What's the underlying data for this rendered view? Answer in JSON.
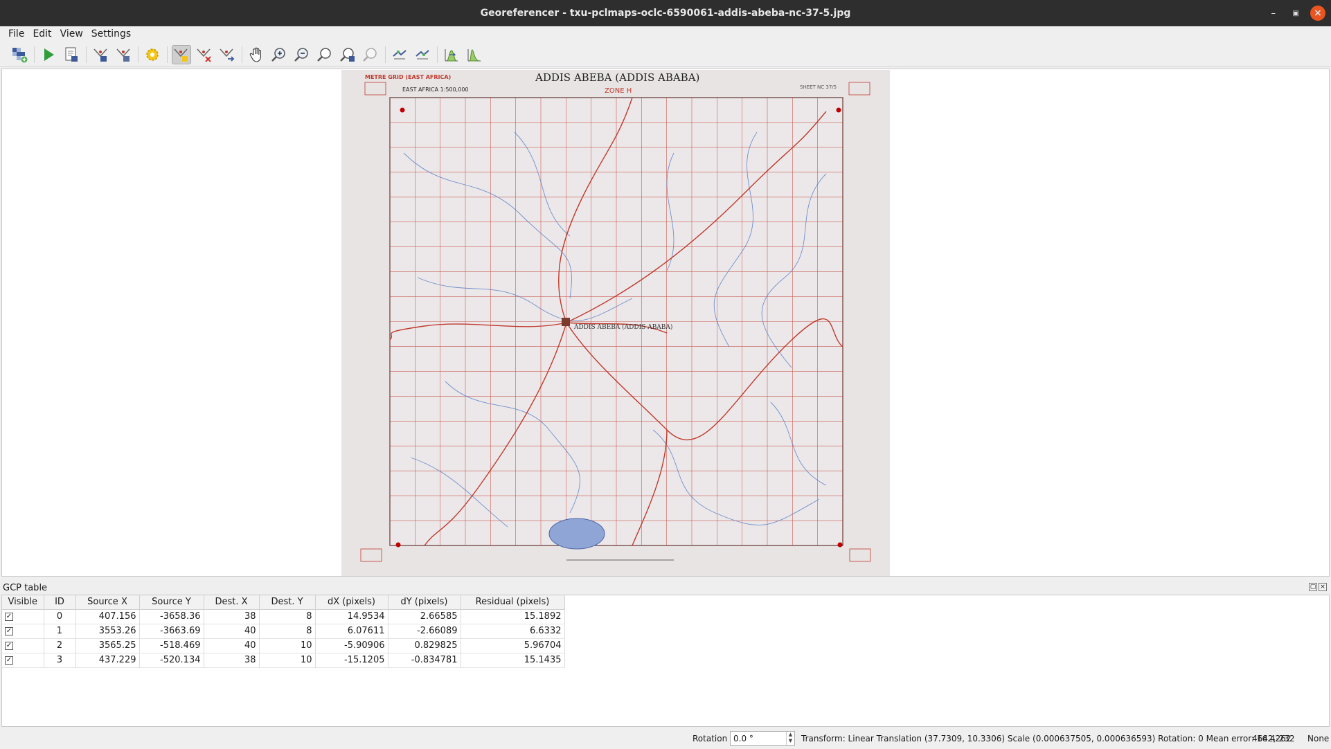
{
  "window": {
    "title": "Georeferencer - txu-pclmaps-oclc-6590061-addis-abeba-nc-37-5.jpg"
  },
  "menu": [
    "File",
    "Edit",
    "View",
    "Settings"
  ],
  "toolbar": {
    "buttons": [
      {
        "name": "open-raster-icon"
      },
      {
        "name": "start-georeferencing-icon"
      },
      {
        "name": "generate-gdal-script-icon"
      },
      {
        "name": "load-gcp-points-icon"
      },
      {
        "name": "save-gcp-points-icon"
      },
      {
        "name": "transformation-settings-icon"
      },
      {
        "name": "add-point-icon",
        "active": true
      },
      {
        "name": "delete-point-icon"
      },
      {
        "name": "move-gcp-point-icon"
      },
      {
        "name": "pan-icon"
      },
      {
        "name": "zoom-in-icon"
      },
      {
        "name": "zoom-out-icon"
      },
      {
        "name": "zoom-to-layer-icon"
      },
      {
        "name": "zoom-last-icon"
      },
      {
        "name": "zoom-next-icon"
      },
      {
        "name": "link-georeferencer-to-qgis-icon"
      },
      {
        "name": "link-qgis-to-georeferencer-icon"
      },
      {
        "name": "full-histogram-stretch-icon"
      },
      {
        "name": "local-histogram-stretch-icon"
      }
    ]
  },
  "map": {
    "title": "ADDIS ABEBA (ADDIS ABABA)",
    "grid_label": "METRE GRID (EAST AFRICA)",
    "series": "EAST AFRICA 1:500,000",
    "zone": "ZONE H",
    "sheet": "SHEET NC 37/5",
    "city_label": "ADDIS ABEBA (ADDIS ABABA)"
  },
  "gcp_panel": {
    "title": "GCP table",
    "columns": [
      "Visible",
      "ID",
      "Source X",
      "Source Y",
      "Dest. X",
      "Dest. Y",
      "dX (pixels)",
      "dY (pixels)",
      "Residual (pixels)"
    ],
    "rows": [
      {
        "visible": true,
        "id": "0",
        "source_x": "407.156",
        "source_y": "-3658.36",
        "dest_x": "38",
        "dest_y": "8",
        "dx": "14.9534",
        "dy": "2.66585",
        "residual": "15.1892"
      },
      {
        "visible": true,
        "id": "1",
        "source_x": "3553.26",
        "source_y": "-3663.69",
        "dest_x": "40",
        "dest_y": "8",
        "dx": "6.07611",
        "dy": "-2.66089",
        "residual": "6.6332"
      },
      {
        "visible": true,
        "id": "2",
        "source_x": "3565.25",
        "source_y": "-518.469",
        "dest_x": "40",
        "dest_y": "10",
        "dx": "-5.90906",
        "dy": "0.829825",
        "residual": "5.96704"
      },
      {
        "visible": true,
        "id": "3",
        "source_x": "437.229",
        "source_y": "-520.134",
        "dest_x": "38",
        "dest_y": "10",
        "dx": "-15.1205",
        "dy": "-0.834781",
        "residual": "15.1435"
      }
    ]
  },
  "status": {
    "rotation_label": "Rotation",
    "rotation_value": "0.0 °",
    "transform": "Transform: Linear Translation (37.7309, 10.3306) Scale (0.000637505, 0.000636593) Rotation: 0 Mean error: 16.4262",
    "coords": "4642,-232",
    "crs": "None"
  },
  "colors": {
    "titlebar": "#2e2e2e",
    "close_button": "#e95420",
    "map_red": "#c0392b",
    "map_blue": "#5b7fc4"
  }
}
